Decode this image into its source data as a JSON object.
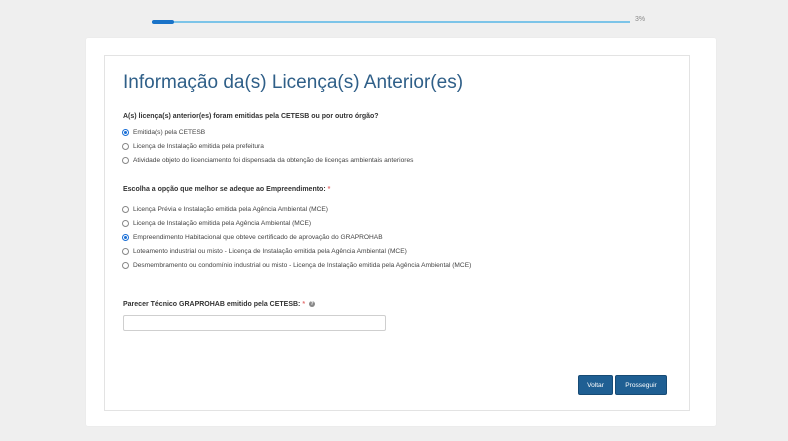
{
  "progress": {
    "percent_label": "3%",
    "value": 0.03
  },
  "title": "Informação da(s) Licença(s) Anterior(es)",
  "question1": {
    "label": "A(s) licença(s) anterior(es) foram emitidas pela CETESB ou por outro órgão?",
    "options": [
      {
        "label": "Emitida(s) pela CETESB",
        "checked": true
      },
      {
        "label": "Licença de Instalação emitida pela prefeitura",
        "checked": false
      },
      {
        "label": "Atividade objeto do licenciamento foi dispensada da obtenção de licenças ambientais anteriores",
        "checked": false
      }
    ]
  },
  "question2": {
    "label": "Escolha a opção que melhor se adeque ao Empreendimento:",
    "required_mark": "*",
    "options": [
      {
        "label": "Licença Prévia e Instalação emitida pela Agência Ambiental (MCE)",
        "checked": false
      },
      {
        "label": "Licença de Instalação emitida pela Agência Ambiental (MCE)",
        "checked": false
      },
      {
        "label": "Empreendimento Habitacional que obteve certificado de aprovação do GRAPROHAB",
        "checked": true
      },
      {
        "label": "Loteamento industrial ou misto - Licença de Instalação emitida pela Agência Ambiental (MCE)",
        "checked": false
      },
      {
        "label": "Desmembramento ou condomínio industrial ou misto - Licença de Instalação emitida pela Agência Ambiental (MCE)",
        "checked": false
      }
    ]
  },
  "parecer": {
    "label": "Parecer Técnico GRAPROHAB emitido pela CETESB:",
    "required_mark": "*",
    "help_icon": "question-circle-icon",
    "value": "",
    "placeholder": ""
  },
  "buttons": {
    "back": "Voltar",
    "next": "Prosseguir"
  },
  "colors": {
    "accent": "#1f5f93",
    "title": "#2f5f88",
    "progress": "#1a73c8"
  }
}
